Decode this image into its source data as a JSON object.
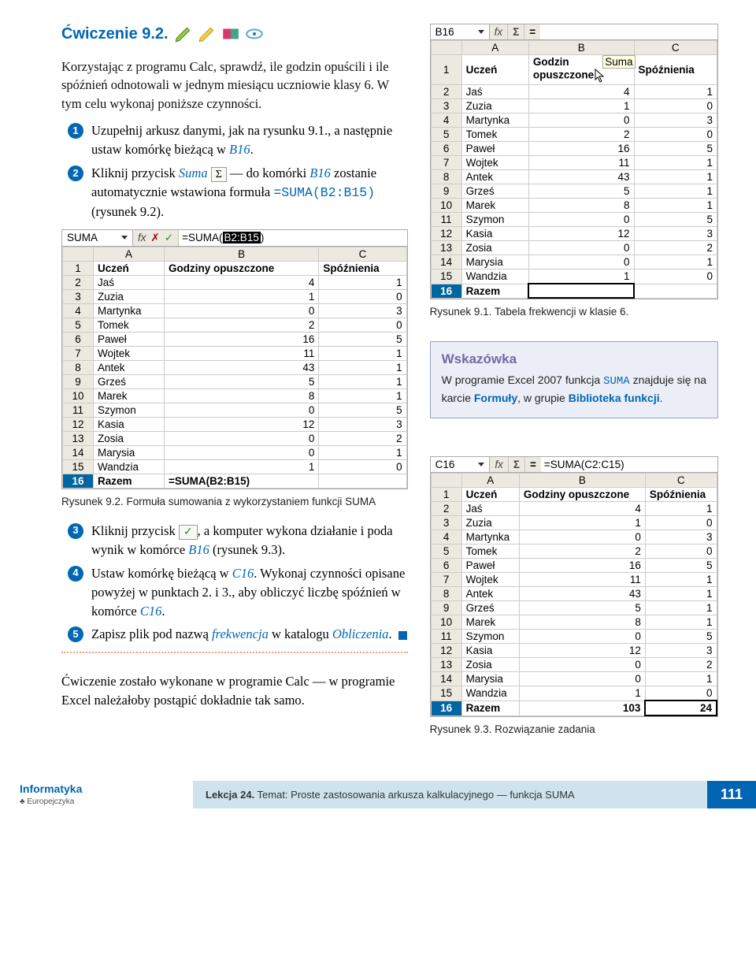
{
  "exercise_title": "Ćwiczenie 9.2.",
  "intro": "Korzystając z programu Calc, sprawdź, ile godzin opuścili i ile spóźnień odnotowali w jednym miesiącu uczniowie klasy 6. W tym celu wykonaj poniższe czynności.",
  "steps": {
    "s1a": "Uzupełnij arkusz danymi, jak na rysunku 9.1., a następnie ustaw komórkę bieżącą w ",
    "s1b": "B16",
    "s1c": ".",
    "s2a": "Kliknij przycisk ",
    "s2b": "Suma",
    "s2btn": "Σ",
    "s2c": " — do komórki ",
    "s2d": "B16",
    "s2e": " zostanie automatycznie wstawiona formuła ",
    "s2f": "=SUMA(B2:B15)",
    "s2g": " (rysunek 9.2).",
    "s3a": "Kliknij przycisk ",
    "s3btn": "✓",
    "s3b": ", a komputer wykona działanie i poda wynik w komórce ",
    "s3c": "B16",
    "s3d": " (rysunek 9.3).",
    "s4a": "Ustaw komórkę bieżącą w ",
    "s4b": "C16",
    "s4c": ". Wykonaj czynności opisane powyżej w punktach 2. i 3., aby obliczyć liczbę spóźnień w komórce ",
    "s4d": "C16",
    "s4e": ".",
    "s5a": "Zapisz plik pod nazwą ",
    "s5b": "frekwencja",
    "s5c": " w katalogu ",
    "s5d": "Obliczenia",
    "s5e": "."
  },
  "note": "Ćwiczenie zostało wykonane w programie Calc — w programie Excel należałoby postąpić dokładnie tak samo.",
  "captions": {
    "c91": "Rysunek 9.1. Tabela frekwencji w klasie 6.",
    "c92": "Rysunek 9.2. Formuła sumowania z wykorzystaniem funkcji SUMA",
    "c93": "Rysunek 9.3. Rozwiązanie zadania"
  },
  "hint": {
    "title": "Wskazówka",
    "t1": "W programie Excel 2007 funkcja ",
    "code": "SUMA",
    "t2": " znajduje się na karcie ",
    "kw1": "Formuły",
    "t3": ", w grupie ",
    "kw2": "Biblioteka funkcji",
    "t4": "."
  },
  "sheet": {
    "col_heads": [
      "A",
      "B",
      "C"
    ],
    "row1": [
      "Uczeń",
      "Godziny opuszczone",
      "Spóźnienia"
    ],
    "row1_short": [
      "Uczeń",
      "Godzin",
      "Suma"
    ],
    "rows": [
      [
        "Jaś",
        4,
        1
      ],
      [
        "Zuzia",
        1,
        0
      ],
      [
        "Martynka",
        0,
        3
      ],
      [
        "Tomek",
        2,
        0
      ],
      [
        "Paweł",
        16,
        5
      ],
      [
        "Wojtek",
        11,
        1
      ],
      [
        "Antek",
        43,
        1
      ],
      [
        "Grześ",
        5,
        1
      ],
      [
        "Marek",
        8,
        1
      ],
      [
        "Szymon",
        0,
        5
      ],
      [
        "Kasia",
        12,
        3
      ],
      [
        "Zosia",
        0,
        2
      ],
      [
        "Marysia",
        0,
        1
      ],
      [
        "Wandzia",
        1,
        0
      ]
    ],
    "razem": "Razem",
    "sum_b": 103,
    "sum_c": 24,
    "formula_text": "=SUMA(",
    "formula_sel": "B2:B15",
    "formula_end": ")",
    "formula_c16": "=SUMA(C2:C15)",
    "cell91": "B16",
    "cellSUMA": "SUMA",
    "cellC16": "C16",
    "fx": "fx",
    "sigma": "Σ",
    "eq": "=",
    "x": "✗",
    "check": "✓"
  },
  "footer": {
    "brand1": "Informatyka",
    "brand2": "Europejczyka",
    "lesson_label": "Lekcja 24.",
    "lesson_text": " Temat: Proste zastosowania arkusza kalkulacyjnego — funkcja SUMA",
    "page": "111"
  }
}
